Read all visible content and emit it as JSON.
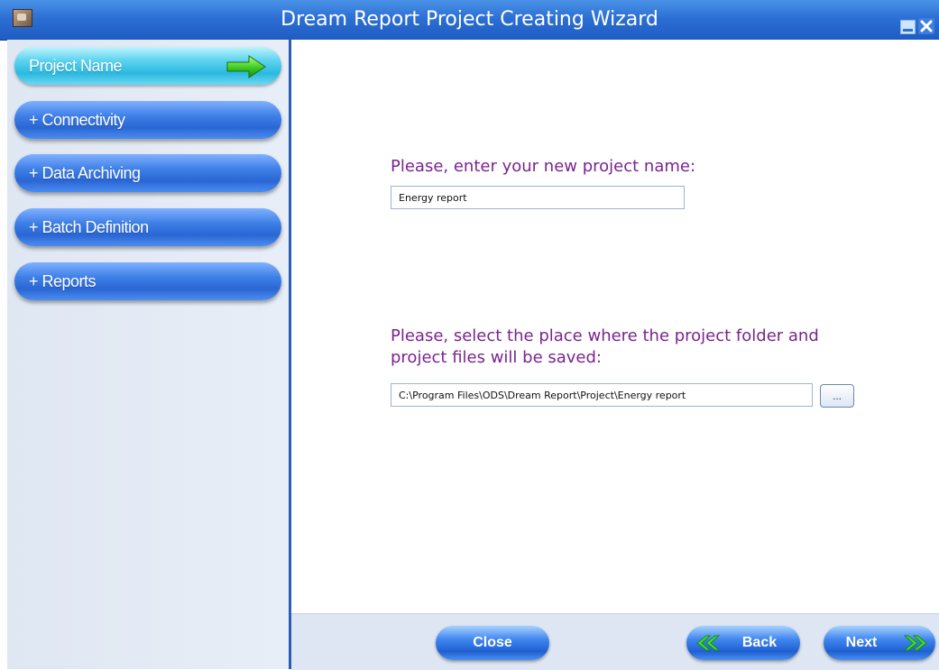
{
  "window": {
    "title": "Dream Report Project Creating Wizard",
    "icons": {
      "app": "app-icon",
      "minimize": "minimize-icon",
      "close": "close-icon"
    }
  },
  "sidebar": {
    "items": [
      {
        "label": "Project Name",
        "active": true,
        "icon": "arrow-right-icon"
      },
      {
        "label": "+ Connectivity",
        "active": false
      },
      {
        "label": "+ Data Archiving",
        "active": false
      },
      {
        "label": "+ Batch Definition",
        "active": false
      },
      {
        "label": "+ Reports",
        "active": false
      }
    ]
  },
  "main": {
    "project_name_prompt": "Please, enter your new project name:",
    "project_name_value": "Energy report",
    "folder_prompt_line1": "Please, select the place where the project folder and",
    "folder_prompt_line2": "project files will be saved:",
    "folder_path_value": "C:\\Program Files\\ODS\\Dream Report\\Project\\Energy report",
    "browse_label": "..."
  },
  "footer": {
    "close_label": "Close",
    "back_label": "Back",
    "next_label": "Next"
  },
  "colors": {
    "titlebar": "#2c6fd4",
    "prompt_text": "#7b2390",
    "nav_active": "#2bb8e0",
    "nav_inactive": "#2a66d4",
    "chevron_green": "#2fcf2a"
  }
}
